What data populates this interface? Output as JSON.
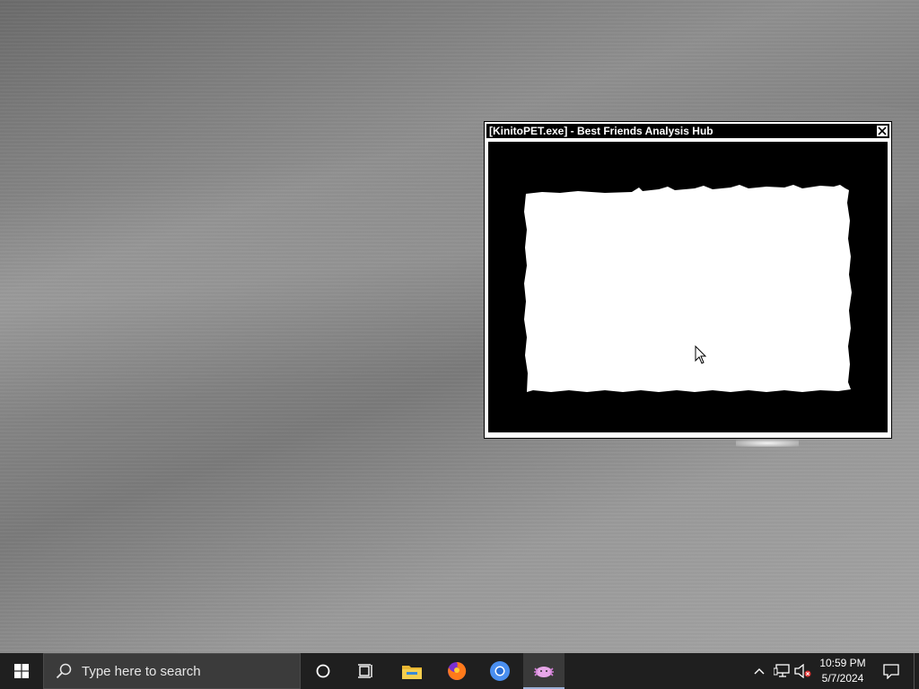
{
  "window": {
    "title": "[KinitoPET.exe] - Best Friends Analysis Hub",
    "close_icon": "close-icon"
  },
  "taskbar": {
    "search_placeholder": "Type here to search",
    "icons": {
      "start": "windows-logo-icon",
      "search": "search-icon",
      "cortana": "cortana-icon",
      "task_view": "task-view-icon",
      "file_explorer": "file-explorer-icon",
      "firefox": "firefox-icon",
      "chrome": "chrome-icon",
      "kinito": "kinito-pet-icon",
      "tray_chevron": "chevron-up-icon",
      "network": "network-icon",
      "volume": "volume-muted-icon",
      "notifications": "action-center-icon"
    }
  },
  "clock": {
    "time": "10:59 PM",
    "date": "5/7/2024"
  },
  "colors": {
    "taskbar_bg": "#1f1f1f",
    "search_bg": "#3b3b3b",
    "window_titlebar": "#000000",
    "window_content": "#000000",
    "panel": "#ffffff",
    "active_indicator": "#9ab0d6"
  }
}
